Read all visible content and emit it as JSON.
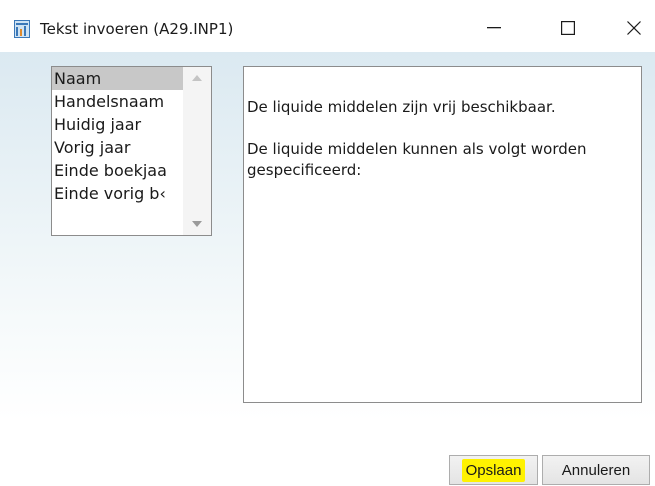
{
  "window": {
    "title": "Tekst invoeren (A29.INP1)",
    "controls": {
      "minimize": "—",
      "maximize": "☐",
      "close": "✕"
    }
  },
  "listbox": {
    "items": [
      {
        "label": "Naam",
        "selected": true
      },
      {
        "label": "Handelsnaam",
        "selected": false
      },
      {
        "label": "Huidig jaar",
        "selected": false
      },
      {
        "label": "Vorig jaar",
        "selected": false
      },
      {
        "label": "Einde boekjaa",
        "selected": false
      },
      {
        "label": "Einde vorig b‹",
        "selected": false
      }
    ]
  },
  "editor": {
    "paragraphs": [
      "De liquide middelen zijn vrij beschikbaar.",
      "De liquide middelen kunnen als volgt worden gespecificeerd:"
    ]
  },
  "buttons": {
    "save_label": "Opslaan",
    "save_highlight_color": "#fff200",
    "cancel_label": "Annuleren"
  }
}
